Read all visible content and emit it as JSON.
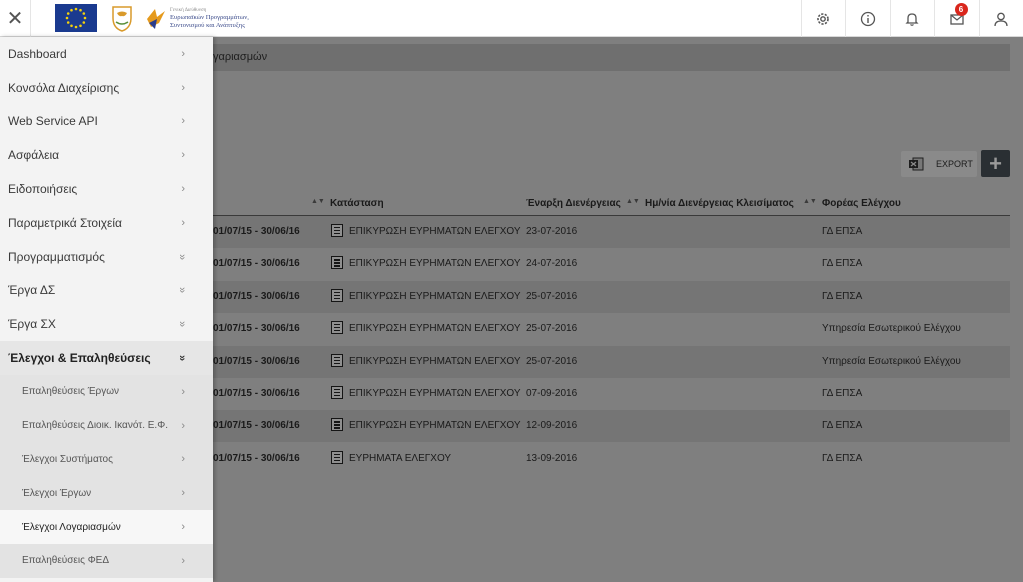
{
  "header": {
    "logo_dg_line1": "Γενική Διεύθυνση",
    "logo_dg_line2": "Ευρωπαϊκών Προγραμμάτων,",
    "logo_dg_line3": "Συντονισμού και Ανάπτυξης",
    "notification_count": "6"
  },
  "breadcrumb": "γαριασμών",
  "toolbar": {
    "export_label": "EXPORT",
    "add_label": "+"
  },
  "table": {
    "columns": [
      "Κατάσταση",
      "Έναρξη Διενέργειας",
      "Ημ/νία Διενέργειας Κλεισίματος",
      "Φορέας Ελέγχου"
    ],
    "rows": [
      {
        "period": "01/07/15 - 30/06/16",
        "status": "ΕΠΙΚΥΡΩΣΗ ΕΥΡΗΜΑΤΩΝ ΕΛΕΓΧΟΥ",
        "start": "23-07-2016",
        "close": "",
        "body": "ΓΔ ΕΠΣΑ"
      },
      {
        "period": "01/07/15 - 30/06/16",
        "status": "ΕΠΙΚΥΡΩΣΗ ΕΥΡΗΜΑΤΩΝ ΕΛΕΓΧΟΥ",
        "start": "24-07-2016",
        "close": "",
        "body": "ΓΔ ΕΠΣΑ"
      },
      {
        "period": "01/07/15 - 30/06/16",
        "status": "ΕΠΙΚΥΡΩΣΗ ΕΥΡΗΜΑΤΩΝ ΕΛΕΓΧΟΥ",
        "start": "25-07-2016",
        "close": "",
        "body": "ΓΔ ΕΠΣΑ"
      },
      {
        "period": "01/07/15 - 30/06/16",
        "status": "ΕΠΙΚΥΡΩΣΗ ΕΥΡΗΜΑΤΩΝ ΕΛΕΓΧΟΥ",
        "start": "25-07-2016",
        "close": "",
        "body": "Υπηρεσία Εσωτερικού Ελέγχου"
      },
      {
        "period": "01/07/15 - 30/06/16",
        "status": "ΕΠΙΚΥΡΩΣΗ ΕΥΡΗΜΑΤΩΝ ΕΛΕΓΧΟΥ",
        "start": "25-07-2016",
        "close": "",
        "body": "Υπηρεσία Εσωτερικού Ελέγχου"
      },
      {
        "period": "01/07/15 - 30/06/16",
        "status": "ΕΠΙΚΥΡΩΣΗ ΕΥΡΗΜΑΤΩΝ ΕΛΕΓΧΟΥ",
        "start": "07-09-2016",
        "close": "",
        "body": "ΓΔ ΕΠΣΑ"
      },
      {
        "period": "01/07/15 - 30/06/16",
        "status": "ΕΠΙΚΥΡΩΣΗ ΕΥΡΗΜΑΤΩΝ ΕΛΕΓΧΟΥ",
        "start": "12-09-2016",
        "close": "",
        "body": "ΓΔ ΕΠΣΑ"
      },
      {
        "period": "01/07/15 - 30/06/16",
        "status": "ΕΥΡΗΜΑΤΑ ΕΛΕΓΧΟΥ",
        "start": "13-09-2016",
        "close": "",
        "body": "ΓΔ ΕΠΣΑ"
      }
    ]
  },
  "sidebar": {
    "items": [
      {
        "label": "Dashboard",
        "chevron": "›"
      },
      {
        "label": "Κονσόλα Διαχείρισης",
        "chevron": "›"
      },
      {
        "label": "Web Service API",
        "chevron": "›"
      },
      {
        "label": "Ασφάλεια",
        "chevron": "›"
      },
      {
        "label": "Ειδοποιήσεις",
        "chevron": "›"
      },
      {
        "label": "Παραμετρικά Στοιχεία",
        "chevron": "›"
      },
      {
        "label": "Προγραμματισμός",
        "chevron": "»"
      },
      {
        "label": "Έργα ΔΣ",
        "chevron": "»"
      },
      {
        "label": "Έργα ΣΧ",
        "chevron": "»"
      },
      {
        "label": "Έλεγχοι & Επαληθεύσεις",
        "chevron": "»"
      }
    ],
    "sub_items": [
      {
        "label": "Επαληθεύσεις Έργων",
        "chevron": "›"
      },
      {
        "label": "Επαληθεύσεις Διοικ. Ικανότ. Ε.Φ.",
        "chevron": "›"
      },
      {
        "label": "Έλεγχοι Συστήματος",
        "chevron": "›"
      },
      {
        "label": "Έλεγχοι Έργων",
        "chevron": "›"
      },
      {
        "label": "Έλεγχοι Λογαριασμών",
        "chevron": "›"
      },
      {
        "label": "Επαληθεύσεις ΦΕΔ",
        "chevron": "›"
      }
    ]
  },
  "colors": {
    "overlay": "#7f7f7f",
    "sidebar": "#f3f3f3",
    "badge": "#d9261c",
    "eu_blue": "#1a3a8f"
  }
}
